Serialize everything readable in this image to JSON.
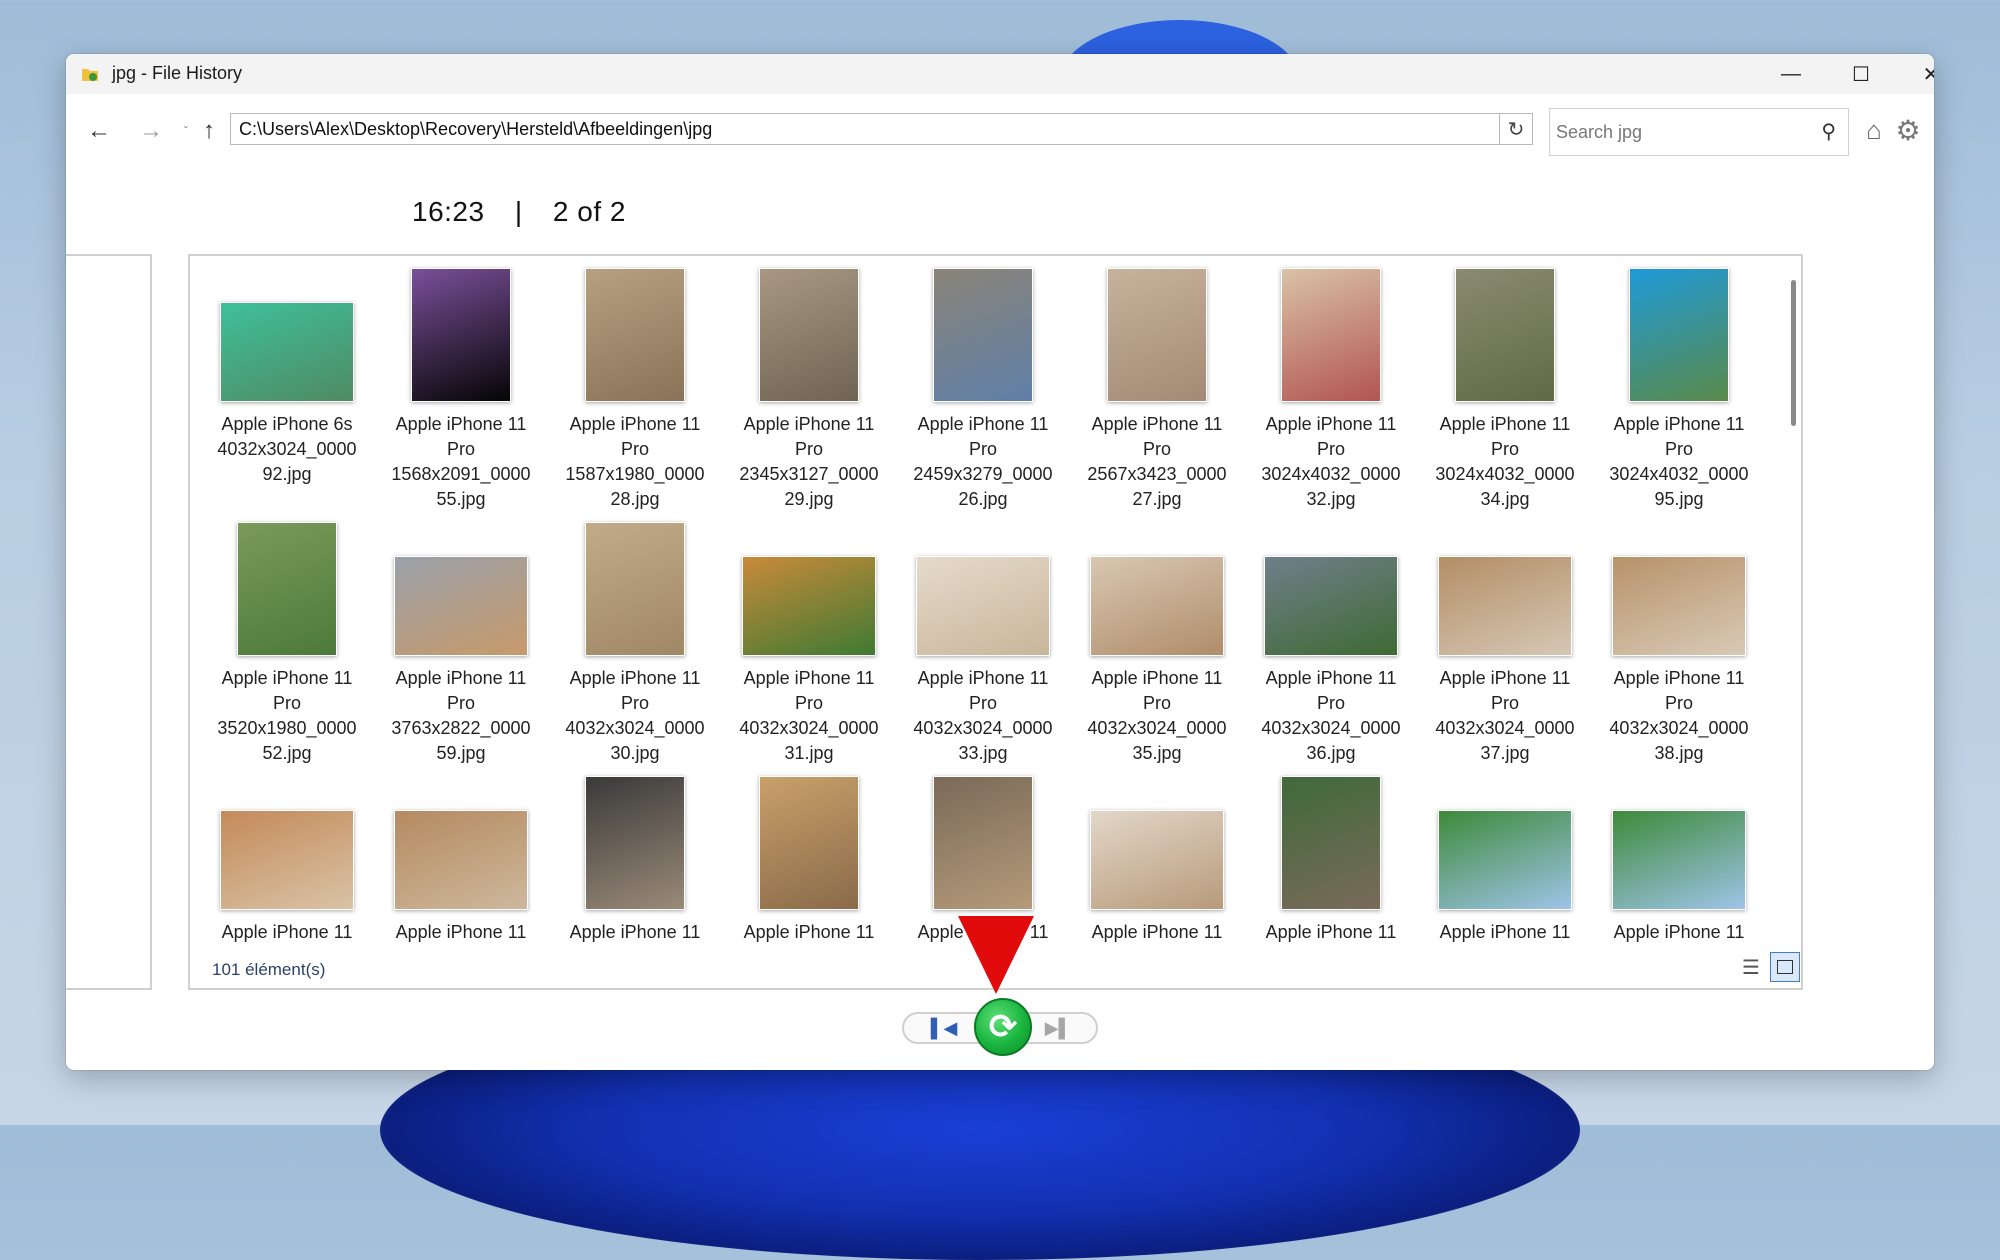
{
  "window": {
    "title": "jpg - File History",
    "minimize_icon": "minimize-icon",
    "maximize_icon": "maximize-icon",
    "close_icon": "close-icon"
  },
  "toolbar": {
    "address": "C:\\Users\\Alex\\Desktop\\Recovery\\Hersteld\\Afbeeldingen\\jpg",
    "search_placeholder": "Search jpg"
  },
  "timeline": {
    "time": "16:23",
    "separator": "|",
    "position": "2 of 2"
  },
  "files": [
    {
      "l1": "Apple iPhone 6s",
      "l2": "4032x3024_0000",
      "l3": "92.jpg",
      "l4": "",
      "shape": "land",
      "c1": "#4f8a63",
      "c2": "#3fc09a"
    },
    {
      "l1": "Apple iPhone 11",
      "l2": "Pro",
      "l3": "1568x2091_0000",
      "l4": "55.jpg",
      "shape": "port",
      "c1": "#050505",
      "c2": "#7a4f9a"
    },
    {
      "l1": "Apple iPhone 11",
      "l2": "Pro",
      "l3": "1587x1980_0000",
      "l4": "28.jpg",
      "shape": "port",
      "c1": "#8a7258",
      "c2": "#b7a081"
    },
    {
      "l1": "Apple iPhone 11",
      "l2": "Pro",
      "l3": "2345x3127_0000",
      "l4": "29.jpg",
      "shape": "port",
      "c1": "#6f6352",
      "c2": "#a89882"
    },
    {
      "l1": "Apple iPhone 11",
      "l2": "Pro",
      "l3": "2459x3279_0000",
      "l4": "26.jpg",
      "shape": "port",
      "c1": "#5f7fa8",
      "c2": "#8a8478"
    },
    {
      "l1": "Apple iPhone 11",
      "l2": "Pro",
      "l3": "2567x3423_0000",
      "l4": "27.jpg",
      "shape": "port",
      "c1": "#a38a74",
      "c2": "#c7b29b"
    },
    {
      "l1": "Apple iPhone 11",
      "l2": "Pro",
      "l3": "3024x4032_0000",
      "l4": "32.jpg",
      "shape": "port",
      "c1": "#b25550",
      "c2": "#d9c2a6"
    },
    {
      "l1": "Apple iPhone 11",
      "l2": "Pro",
      "l3": "3024x4032_0000",
      "l4": "34.jpg",
      "shape": "port",
      "c1": "#5f6b45",
      "c2": "#8a8a70"
    },
    {
      "l1": "Apple iPhone 11",
      "l2": "Pro",
      "l3": "3024x4032_0000",
      "l4": "95.jpg",
      "shape": "port",
      "c1": "#5a8a4a",
      "c2": "#1f9ad8"
    },
    {
      "l1": "Apple iPhone 11",
      "l2": "Pro",
      "l3": "3520x1980_0000",
      "l4": "52.jpg",
      "shape": "port",
      "c1": "#4c7a3a",
      "c2": "#7a9a58"
    },
    {
      "l1": "Apple iPhone 11",
      "l2": "Pro",
      "l3": "3763x2822_0000",
      "l4": "59.jpg",
      "shape": "land",
      "c1": "#c79a6a",
      "c2": "#9aa0aa"
    },
    {
      "l1": "Apple iPhone 11",
      "l2": "Pro",
      "l3": "4032x3024_0000",
      "l4": "30.jpg",
      "shape": "port",
      "c1": "#a08866",
      "c2": "#c2ab88"
    },
    {
      "l1": "Apple iPhone 11",
      "l2": "Pro",
      "l3": "4032x3024_0000",
      "l4": "31.jpg",
      "shape": "land",
      "c1": "#3f7a32",
      "c2": "#c98a3a"
    },
    {
      "l1": "Apple iPhone 11",
      "l2": "Pro",
      "l3": "4032x3024_0000",
      "l4": "33.jpg",
      "shape": "land",
      "c1": "#c9b69a",
      "c2": "#e5dacb"
    },
    {
      "l1": "Apple iPhone 11",
      "l2": "Pro",
      "l3": "4032x3024_0000",
      "l4": "35.jpg",
      "shape": "land",
      "c1": "#b08d6a",
      "c2": "#d8c7b2"
    },
    {
      "l1": "Apple iPhone 11",
      "l2": "Pro",
      "l3": "4032x3024_0000",
      "l4": "36.jpg",
      "shape": "land",
      "c1": "#3f6a34",
      "c2": "#6f7f8a"
    },
    {
      "l1": "Apple iPhone 11",
      "l2": "Pro",
      "l3": "4032x3024_0000",
      "l4": "37.jpg",
      "shape": "land",
      "c1": "#d5c7b4",
      "c2": "#b48e66"
    },
    {
      "l1": "Apple iPhone 11",
      "l2": "Pro",
      "l3": "4032x3024_0000",
      "l4": "38.jpg",
      "shape": "land",
      "c1": "#d8cab6",
      "c2": "#b8926a"
    },
    {
      "l1": "Apple iPhone 11",
      "l2": "",
      "l3": "",
      "l4": "",
      "shape": "land",
      "c1": "#d9c3a6",
      "c2": "#c48a5a"
    },
    {
      "l1": "Apple iPhone 11",
      "l2": "",
      "l3": "",
      "l4": "",
      "shape": "land",
      "c1": "#cdb89c",
      "c2": "#b58a60"
    },
    {
      "l1": "Apple iPhone 11",
      "l2": "",
      "l3": "",
      "l4": "",
      "shape": "port",
      "c1": "#9a8a78",
      "c2": "#3a3a3a"
    },
    {
      "l1": "Apple iPhone 11",
      "l2": "",
      "l3": "",
      "l4": "",
      "shape": "port",
      "c1": "#8a6a4a",
      "c2": "#c9a06a"
    },
    {
      "l1": "Apple iPhone 11",
      "l2": "",
      "l3": "",
      "l4": "",
      "shape": "port",
      "c1": "#b59a7a",
      "c2": "#7a6a58"
    },
    {
      "l1": "Apple iPhone 11",
      "l2": "",
      "l3": "",
      "l4": "",
      "shape": "land",
      "c1": "#b89a7a",
      "c2": "#e2d7c8"
    },
    {
      "l1": "Apple iPhone 11",
      "l2": "",
      "l3": "",
      "l4": "",
      "shape": "port",
      "c1": "#7a6a5a",
      "c2": "#3f6a3a"
    },
    {
      "l1": "Apple iPhone 11",
      "l2": "",
      "l3": "",
      "l4": "",
      "shape": "land",
      "c1": "#9ec4e8",
      "c2": "#3e8a3a"
    },
    {
      "l1": "Apple iPhone 11",
      "l2": "",
      "l3": "",
      "l4": "",
      "shape": "land",
      "c1": "#9ec4e8",
      "c2": "#3e8a3a"
    }
  ],
  "status": {
    "count": "101 élément(s)"
  },
  "controls": {
    "previous_icon": "previous-version-icon",
    "restore_icon": "restore-icon",
    "next_icon": "next-version-icon"
  },
  "annotation": {
    "arrow_color": "#e20b0b",
    "arrow_icon": "red-arrow-down"
  },
  "colors": {
    "accent": "#2f5fb5",
    "restore": "#19b43e",
    "window_bg": "#ffffff"
  }
}
